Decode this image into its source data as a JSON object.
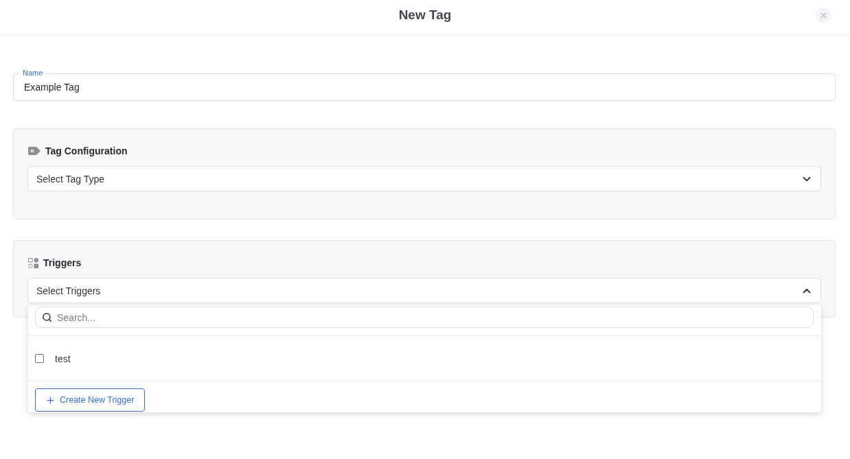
{
  "header": {
    "title": "New Tag"
  },
  "name_field": {
    "label": "Name",
    "value": "Example Tag"
  },
  "sections": [
    {
      "kind": "tag",
      "title": "Tag Configuration",
      "select": {
        "placeholder": "Select Tag Type",
        "expanded": false
      }
    },
    {
      "kind": "triggers",
      "title": "Triggers",
      "select": {
        "placeholder": "Select Triggers",
        "expanded": true
      },
      "dropdown": {
        "search": {
          "placeholder": "Search..."
        },
        "options": [
          {
            "label": "test",
            "checked": false
          }
        ],
        "create_button": "Create New Trigger"
      }
    }
  ]
}
